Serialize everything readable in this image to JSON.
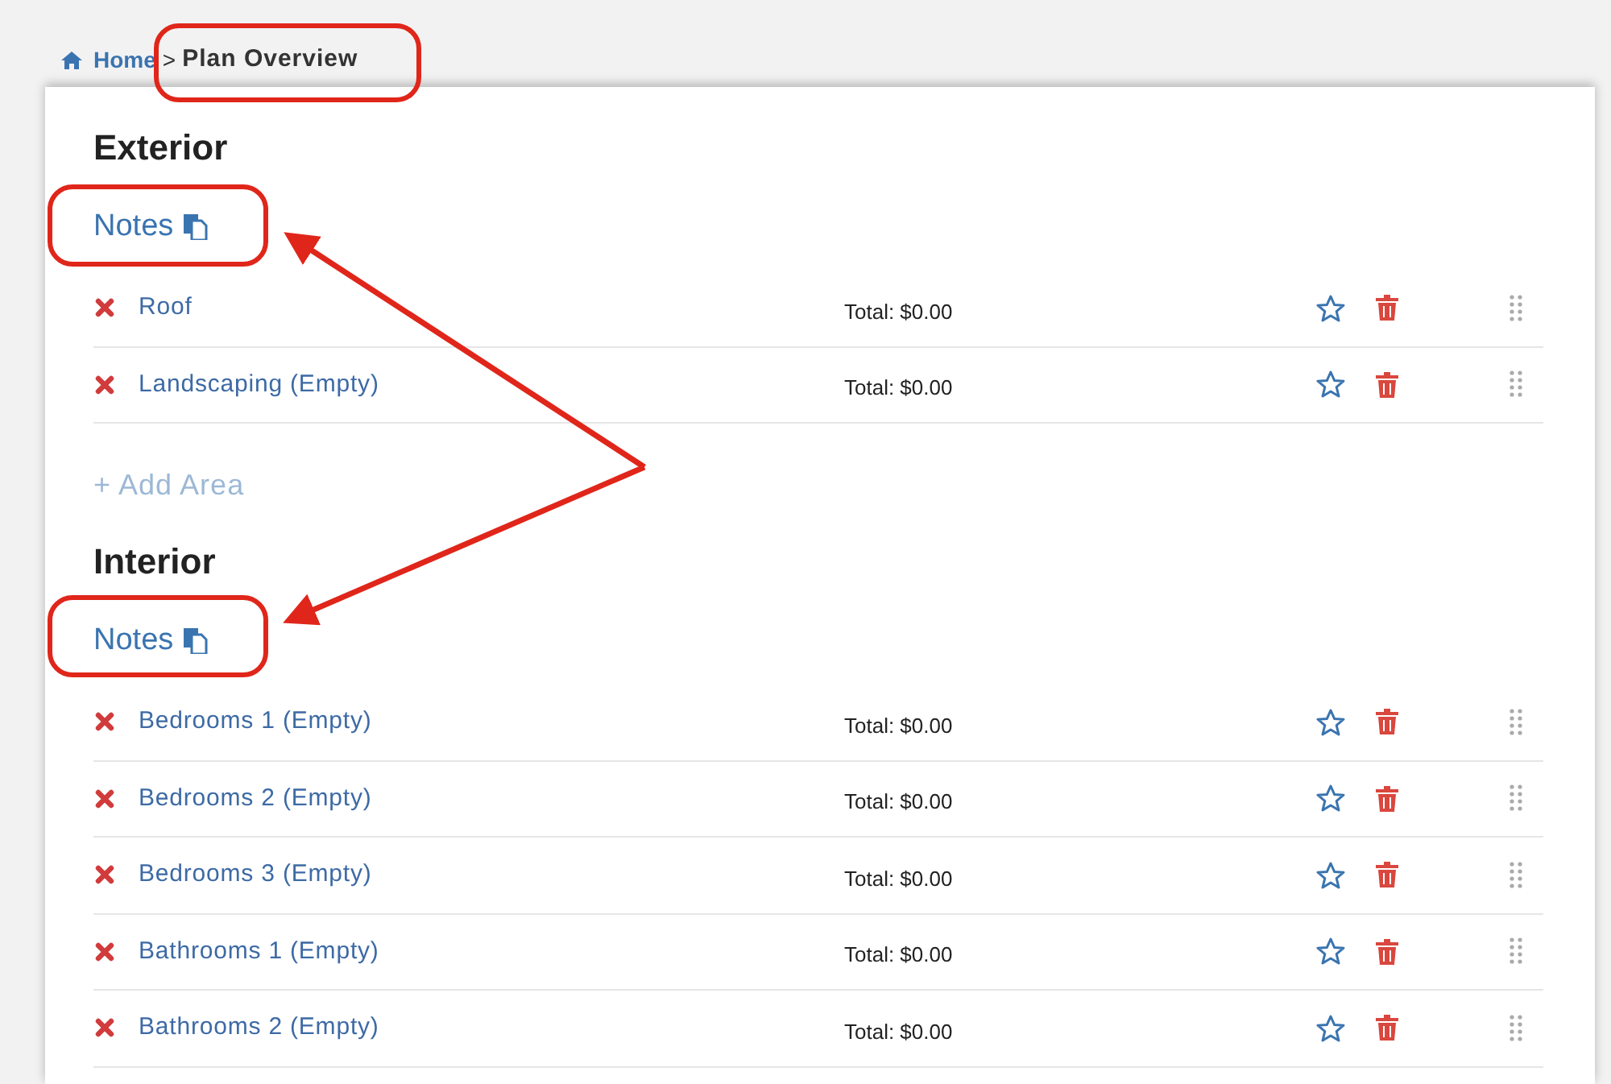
{
  "breadcrumb": {
    "home": "Home",
    "separator": ">",
    "current": "Plan Overview"
  },
  "sections": [
    {
      "title": "Exterior",
      "notes": "Notes",
      "areas": [
        {
          "name": "Roof",
          "total": "Total: $0.00"
        },
        {
          "name": "Landscaping (Empty)",
          "total": "Total: $0.00"
        }
      ],
      "add_label": "+ Add Area"
    },
    {
      "title": "Interior",
      "notes": "Notes",
      "areas": [
        {
          "name": "Bedrooms 1 (Empty)",
          "total": "Total: $0.00"
        },
        {
          "name": "Bedrooms 2 (Empty)",
          "total": "Total: $0.00"
        },
        {
          "name": "Bedrooms 3 (Empty)",
          "total": "Total: $0.00"
        },
        {
          "name": "Bathrooms 1 (Empty)",
          "total": "Total: $0.00"
        },
        {
          "name": "Bathrooms 2 (Empty)",
          "total": "Total: $0.00"
        }
      ]
    }
  ]
}
